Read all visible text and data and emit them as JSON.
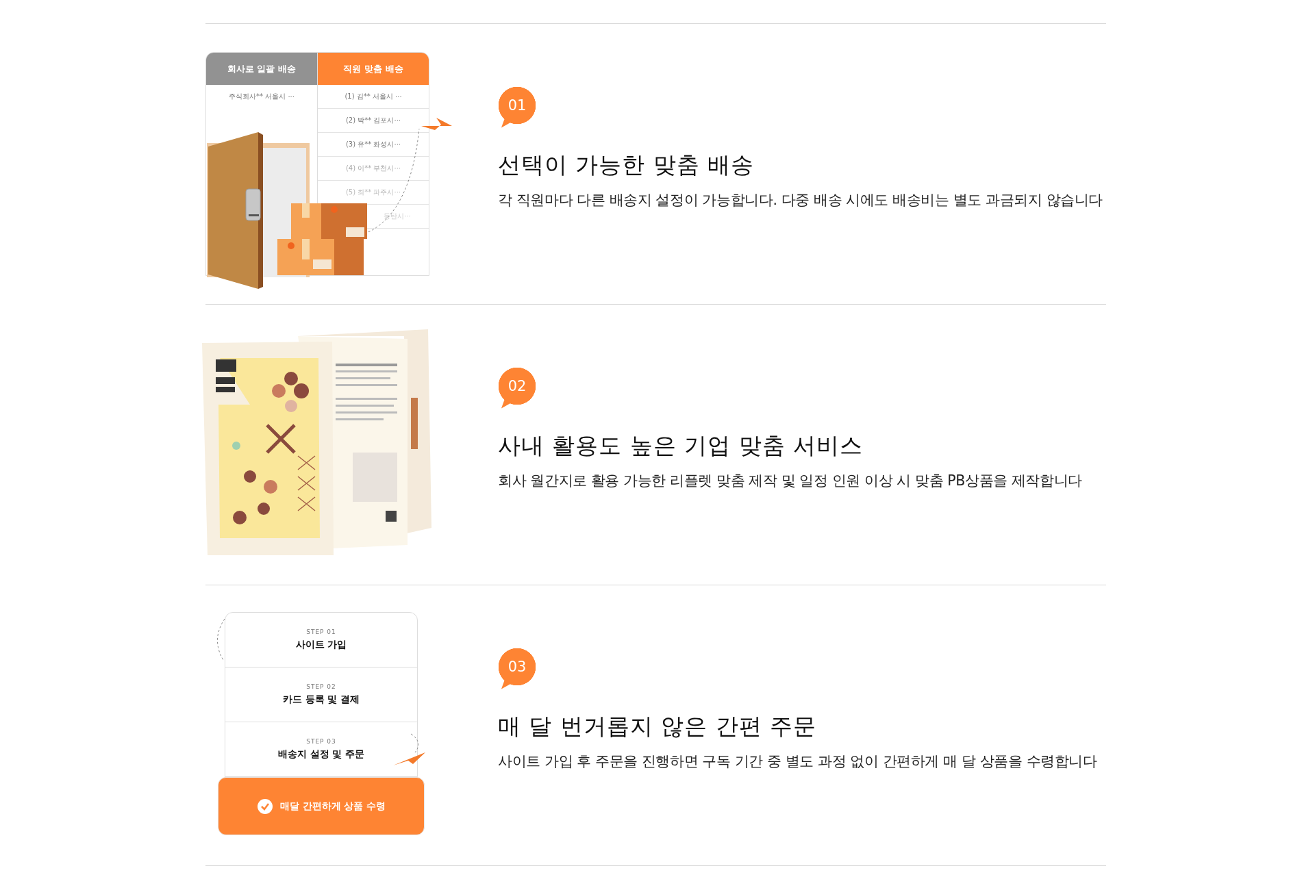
{
  "sections": [
    {
      "kind": "delivery",
      "number": "01",
      "title": "선택이 가능한 맞춤 배송",
      "description": "각 직원마다 다른 배송지 설정이 가능합니다. 다중 배송 시에도 배송비는 별도 과금되지 않습니다",
      "table": {
        "columns": [
          {
            "label": "회사로 일괄 배송",
            "selected": false,
            "rows": [
              "주식회사** 서울시 ···"
            ]
          },
          {
            "label": "직원 맞춤 배송",
            "selected": true,
            "rows": [
              "(1) 김** 서울시 ···",
              "(2) 박** 김포시···",
              "(3) 유** 화성시···",
              "(4) 이** 부천시···",
              "(5) 최** 파주시···",
              "동탄시···"
            ]
          }
        ]
      }
    },
    {
      "kind": "leaflet",
      "number": "02",
      "title": "사내 활용도 높은 기업 맞춤 서비스",
      "description": "회사 월간지로 활용 가능한 리플렛 맞춤 제작 및 일정 인원 이상 시 맞춤 PB상품을 제작합니다"
    },
    {
      "kind": "steps",
      "number": "03",
      "title": "매 달 번거롭지 않은 간편 주문",
      "description": "사이트 가입 후 주문을 진행하면 구독 기간 중 별도 과정 없이 간편하게 매 달 상품을 수령합니다",
      "steps": [
        {
          "label": "STEP 01",
          "title": "사이트 가입"
        },
        {
          "label": "STEP 02",
          "title": "카드 등록 및 결제"
        },
        {
          "label": "STEP 03",
          "title": "배송지 설정 및 주문"
        }
      ],
      "result": "매달 간편하게 상품 수령"
    }
  ]
}
